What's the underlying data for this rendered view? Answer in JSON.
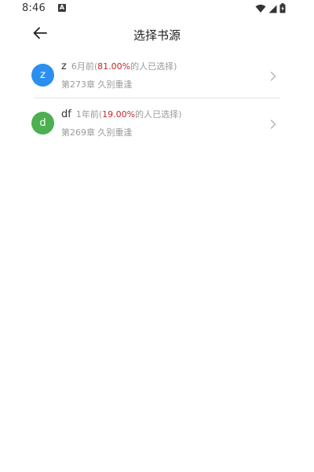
{
  "status_bar": {
    "time": "8:46",
    "notification_icon_letter": "A",
    "icons": [
      "wifi-icon",
      "signal-icon",
      "battery-charging-icon"
    ]
  },
  "toolbar": {
    "title": "选择书源",
    "back_icon": "arrow-left-icon"
  },
  "sources": [
    {
      "avatar_letter": "z",
      "avatar_color": "#2b8ff0",
      "name": "z",
      "time_prefix": "6月前(",
      "percent": "81.00%",
      "time_suffix": "的人已选择)",
      "chapter": "第273章 久别重逢"
    },
    {
      "avatar_letter": "d",
      "avatar_color": "#4caf50",
      "name": "df",
      "time_prefix": "1年前(",
      "percent": "19.00%",
      "time_suffix": "的人已选择)",
      "chapter": "第269章 久别重逢"
    }
  ],
  "colors": {
    "percent_highlight": "#c62828",
    "secondary_text": "#9a9a9a",
    "divider": "#e6e6e6"
  }
}
